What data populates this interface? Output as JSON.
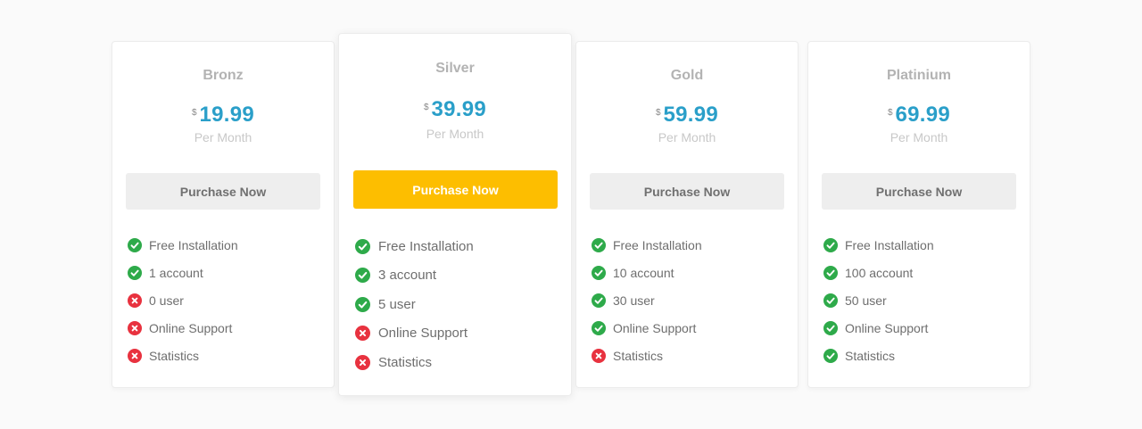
{
  "colors": {
    "background": "#fafafa",
    "price": "#2a9fc9",
    "primary_button": "#fdbe00",
    "check": "#2eaa4a",
    "cross": "#e8323f"
  },
  "plans": [
    {
      "name": "Bronz",
      "currency": "$",
      "price": "19.99",
      "period": "Per Month",
      "button_label": "Purchase Now",
      "featured": false,
      "features": [
        {
          "label": "Free Installation",
          "included": true,
          "icon": "check-icon"
        },
        {
          "label": "1 account",
          "included": true,
          "icon": "check-icon"
        },
        {
          "label": "0 user",
          "included": false,
          "icon": "cross-icon"
        },
        {
          "label": "Online Support",
          "included": false,
          "icon": "cross-icon"
        },
        {
          "label": "Statistics",
          "included": false,
          "icon": "cross-icon"
        }
      ]
    },
    {
      "name": "Silver",
      "currency": "$",
      "price": "39.99",
      "period": "Per Month",
      "button_label": "Purchase Now",
      "featured": true,
      "features": [
        {
          "label": "Free Installation",
          "included": true,
          "icon": "check-icon"
        },
        {
          "label": "3 account",
          "included": true,
          "icon": "check-icon"
        },
        {
          "label": "5 user",
          "included": true,
          "icon": "check-icon"
        },
        {
          "label": "Online Support",
          "included": false,
          "icon": "cross-icon"
        },
        {
          "label": "Statistics",
          "included": false,
          "icon": "cross-icon"
        }
      ]
    },
    {
      "name": "Gold",
      "currency": "$",
      "price": "59.99",
      "period": "Per Month",
      "button_label": "Purchase Now",
      "featured": false,
      "features": [
        {
          "label": "Free Installation",
          "included": true,
          "icon": "check-icon"
        },
        {
          "label": "10 account",
          "included": true,
          "icon": "check-icon"
        },
        {
          "label": "30 user",
          "included": true,
          "icon": "check-icon"
        },
        {
          "label": "Online Support",
          "included": true,
          "icon": "check-icon"
        },
        {
          "label": "Statistics",
          "included": false,
          "icon": "cross-icon"
        }
      ]
    },
    {
      "name": "Platinium",
      "currency": "$",
      "price": "69.99",
      "period": "Per Month",
      "button_label": "Purchase Now",
      "featured": false,
      "features": [
        {
          "label": "Free Installation",
          "included": true,
          "icon": "check-icon"
        },
        {
          "label": "100 account",
          "included": true,
          "icon": "check-icon"
        },
        {
          "label": "50 user",
          "included": true,
          "icon": "check-icon"
        },
        {
          "label": "Online Support",
          "included": true,
          "icon": "check-icon"
        },
        {
          "label": "Statistics",
          "included": true,
          "icon": "check-icon"
        }
      ]
    }
  ]
}
